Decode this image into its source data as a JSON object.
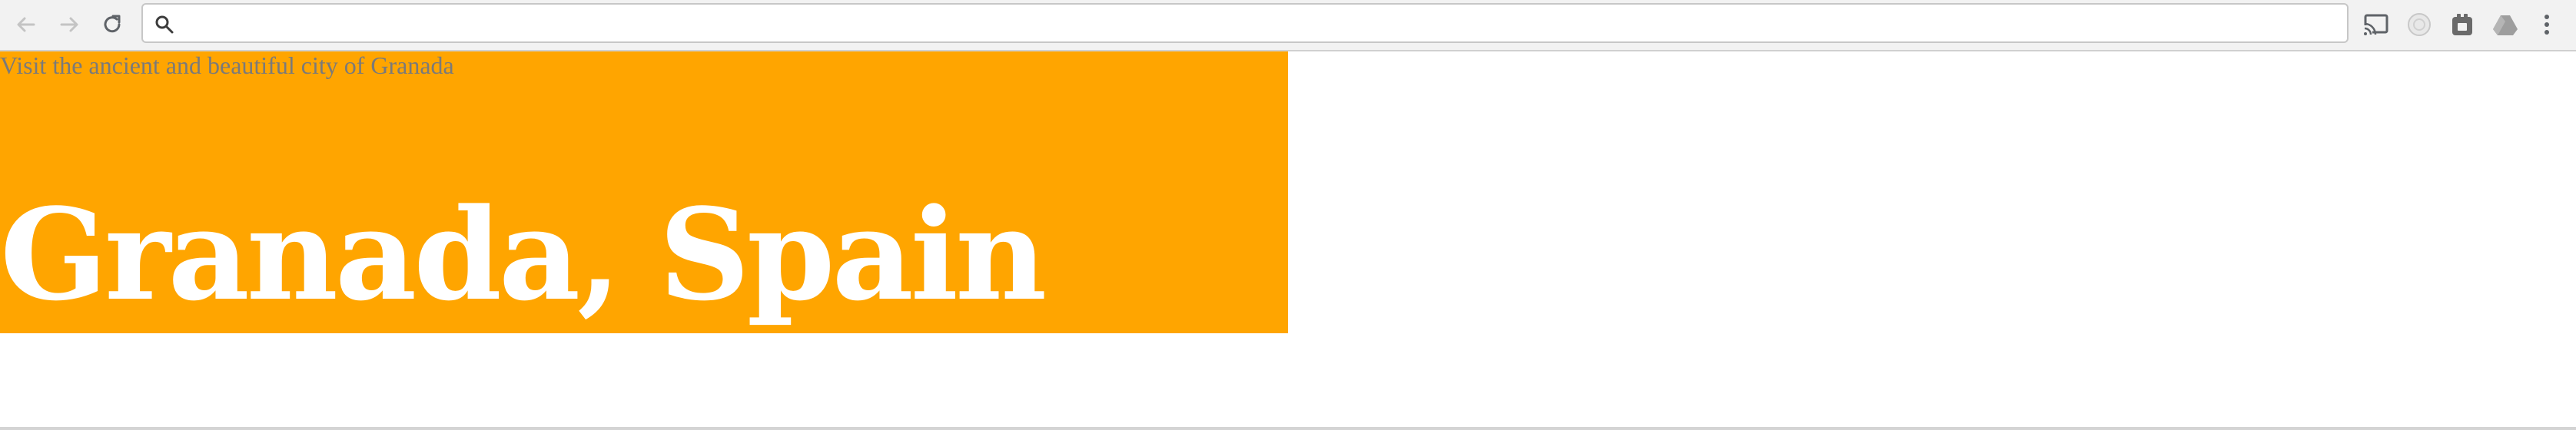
{
  "browser": {
    "address_bar": {
      "value": "",
      "placeholder": ""
    },
    "nav": {
      "back_icon": "back-arrow-icon",
      "forward_icon": "forward-arrow-icon",
      "reload_icon": "reload-icon"
    },
    "extensions": [
      "cast-icon",
      "extension-round-icon",
      "extension-icon",
      "drive-icon",
      "more-menu-icon"
    ]
  },
  "page": {
    "tagline": "Visit the ancient and beautiful city of Granada",
    "title": "Granada, Spain",
    "colors": {
      "hero_background": "#ffa500",
      "title_text": "#ffffff",
      "tagline_text": "#7a7a7a"
    }
  }
}
